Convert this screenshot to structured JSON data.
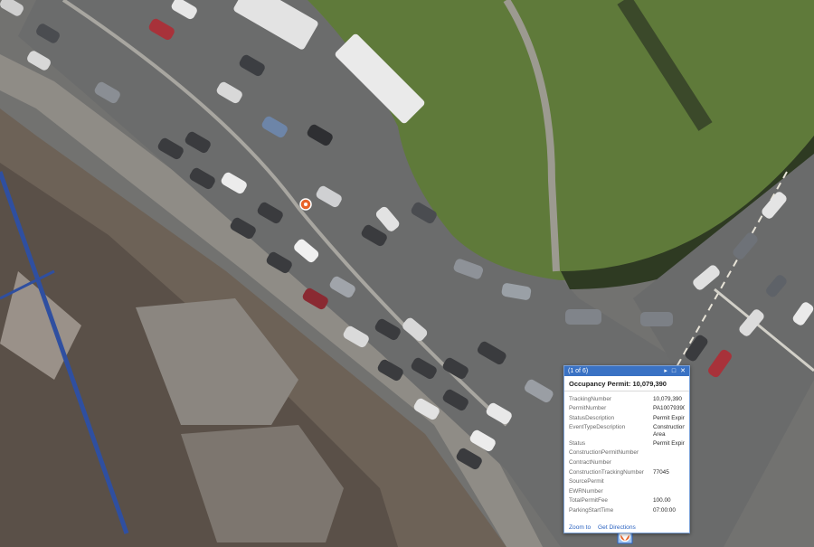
{
  "map": {
    "type": "aerial imagery",
    "markers": [
      {
        "name": "occupancy-permit-marker",
        "color": "#e8632a"
      },
      {
        "name": "selected-permit-marker",
        "color": "#e8632a"
      }
    ]
  },
  "popup": {
    "counter": "(1 of 6)",
    "title": "Occupancy Permit: 10,079,390",
    "fields": [
      {
        "name": "TrackingNumber",
        "value": "10,079,390"
      },
      {
        "name": "PermitNumber",
        "value": "PA10079390"
      },
      {
        "name": "StatusDescription",
        "value": "Permit Expir"
      },
      {
        "name": "EventTypeDescription",
        "value": "Construction Area"
      },
      {
        "name": "Status",
        "value": "Permit Expir"
      },
      {
        "name": "ConstructionPermitNumber",
        "value": ""
      },
      {
        "name": "ContractNumber",
        "value": ""
      },
      {
        "name": "ConstructionTrackingNumber",
        "value": "77045"
      },
      {
        "name": "SourcePermit",
        "value": ""
      },
      {
        "name": "EWRNumber",
        "value": ""
      },
      {
        "name": "TotalPermitFee",
        "value": "100.00"
      },
      {
        "name": "ParkingStartTime",
        "value": "07:00:00"
      }
    ],
    "links": {
      "zoom": "Zoom to",
      "directions": "Get Directions"
    }
  }
}
